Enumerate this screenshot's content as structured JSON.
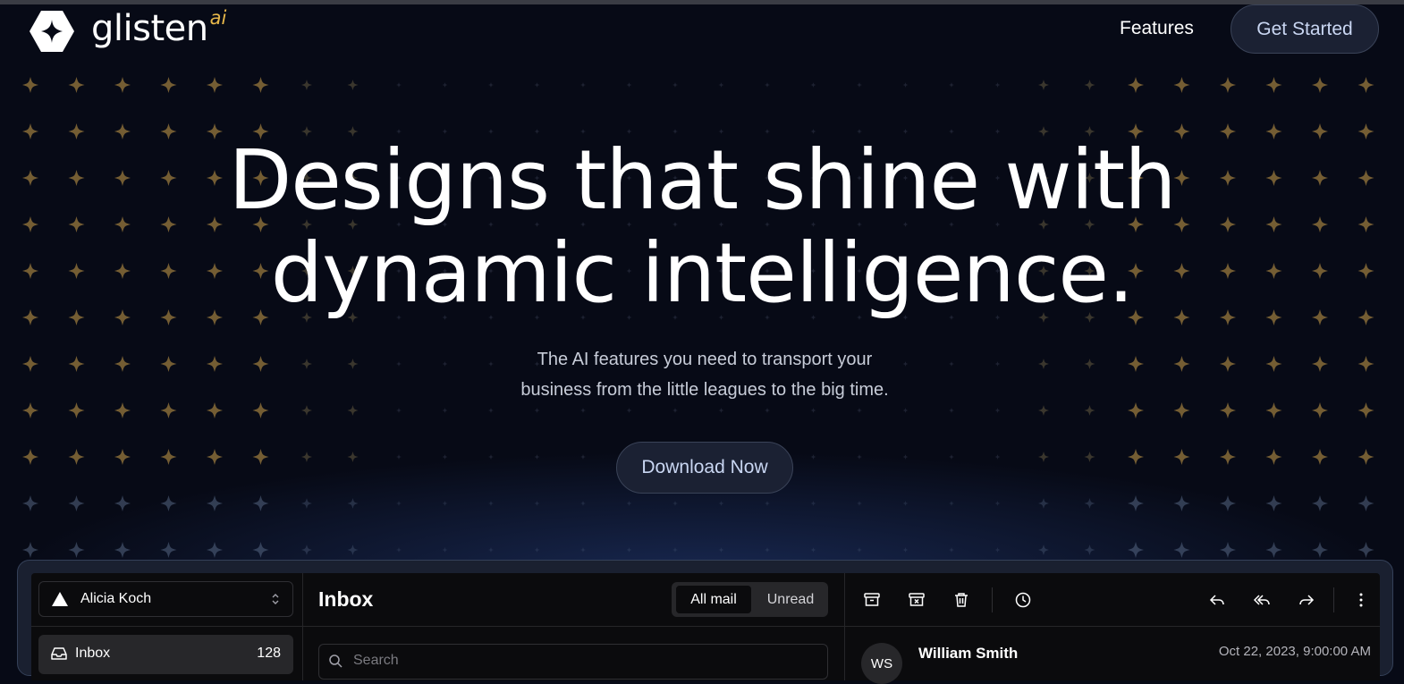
{
  "brand": {
    "name": "glisten",
    "suffix": "ai"
  },
  "nav": {
    "features": "Features",
    "get_started": "Get Started"
  },
  "hero": {
    "title_line1": "Designs that shine with",
    "title_line2": "dynamic intelligence.",
    "subtitle_line1": "The AI features you need to transport your",
    "subtitle_line2": "business from the little leagues to the big time.",
    "cta": "Download Now"
  },
  "colors": {
    "accent_gold": "#e8b84a",
    "background": "#070a16",
    "button_bg": "#1b2133",
    "button_text": "#c9d6f2"
  },
  "mail_app": {
    "account": "Alicia Koch",
    "sidebar": {
      "items": [
        {
          "label": "Inbox",
          "count": "128",
          "icon": "inbox-icon"
        }
      ]
    },
    "title": "Inbox",
    "filters": {
      "all": "All mail",
      "unread": "Unread"
    },
    "search_placeholder": "Search",
    "toolbar_icons": [
      "archive-icon",
      "archive-x-icon",
      "trash-icon",
      "clock-icon",
      "reply-icon",
      "reply-all-icon",
      "forward-icon",
      "more-vertical-icon"
    ],
    "message": {
      "initials": "WS",
      "sender": "William Smith",
      "date": "Oct 22, 2023, 9:00:00 AM"
    }
  }
}
